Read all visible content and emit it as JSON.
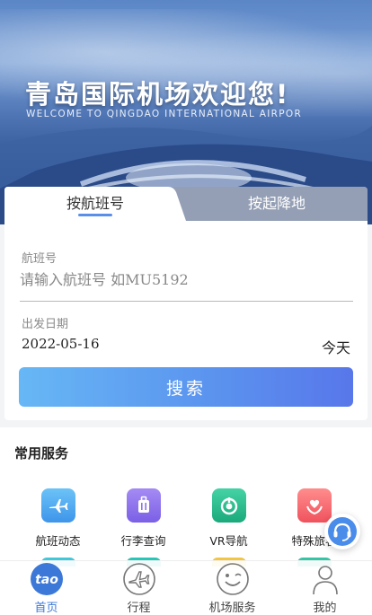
{
  "hero": {
    "title": "青岛国际机场欢迎您!",
    "subtitle": "WELCOME TO QINGDAO INTERNATIONAL AIRPOR"
  },
  "search_card": {
    "tabs": [
      {
        "label": "按航班号",
        "active": true
      },
      {
        "label": "按起降地",
        "active": false
      }
    ],
    "flight_label": "航班号",
    "flight_placeholder": "请输入航班号 如MU5192",
    "date_label": "出发日期",
    "date_value": "2022-05-16",
    "day_label": "今天",
    "search_button": "搜索"
  },
  "services": {
    "title": "常用服务",
    "items": [
      {
        "label": "航班动态",
        "icon": "airplane-icon",
        "color": "#4aa6ef"
      },
      {
        "label": "行李查询",
        "icon": "luggage-icon",
        "color": "#8d72ec"
      },
      {
        "label": "VR导航",
        "icon": "vr-navigation-icon",
        "color": "#2bbf8d"
      },
      {
        "label": "特殊旅客",
        "icon": "heart-hands-icon",
        "color": "#f66a73"
      }
    ]
  },
  "customer_service": {
    "icon": "customer-service-icon"
  },
  "bottom_nav": {
    "items": [
      {
        "label": "首页",
        "icon": "home-logo-icon",
        "active": true
      },
      {
        "label": "行程",
        "icon": "trip-plane-icon",
        "active": false
      },
      {
        "label": "机场服务",
        "icon": "smiley-service-icon",
        "active": false
      },
      {
        "label": "我的",
        "icon": "user-profile-icon",
        "active": false
      }
    ]
  },
  "colors": {
    "accent": "#3c78d8",
    "button_start": "#67b7f5",
    "button_end": "#5877ea"
  }
}
